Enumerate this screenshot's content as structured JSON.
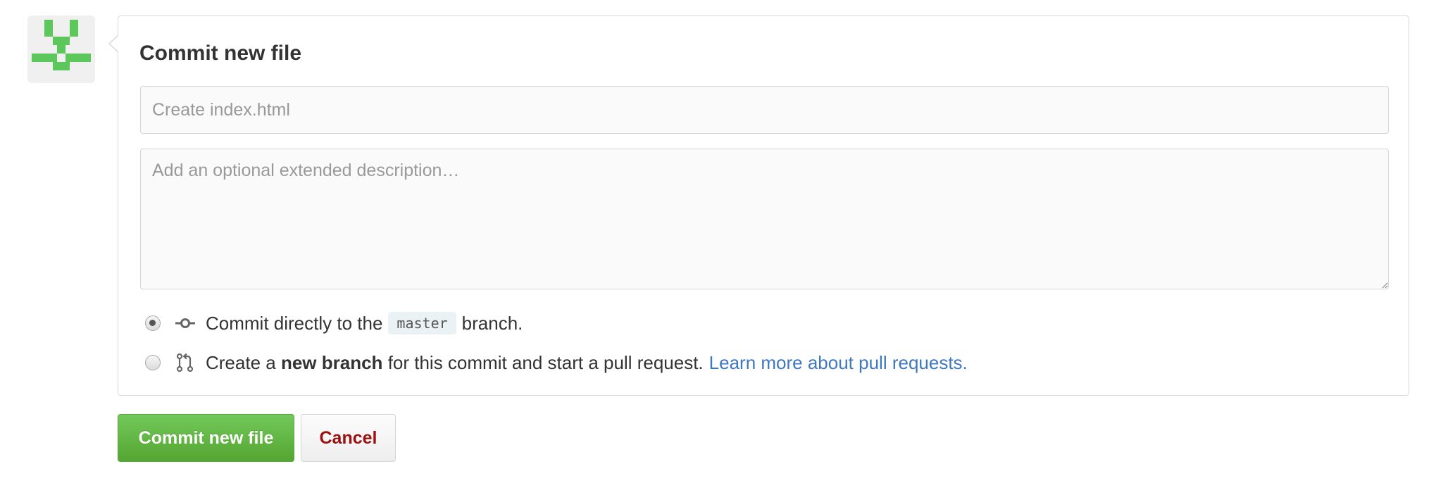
{
  "avatar": {
    "name": "identicon",
    "color": "#5cc85c"
  },
  "commit_form": {
    "heading": "Commit new file",
    "summary_placeholder": "Create index.html",
    "description_placeholder": "Add an optional extended description…",
    "option_direct": {
      "icon": "git-commit-icon",
      "text_before": "Commit directly to the",
      "branch": "master",
      "text_after": "branch.",
      "checked": true
    },
    "option_new_branch": {
      "icon": "git-pull-request-icon",
      "text_before": "Create a",
      "bold_text": "new branch",
      "text_after": "for this commit and start a pull request.",
      "link_text": "Learn more about pull requests.",
      "checked": false
    }
  },
  "actions": {
    "commit_label": "Commit new file",
    "cancel_label": "Cancel"
  },
  "colors": {
    "primary_green": "#55a532",
    "cancel_red": "#9b1111",
    "link_blue": "#4078c0"
  }
}
